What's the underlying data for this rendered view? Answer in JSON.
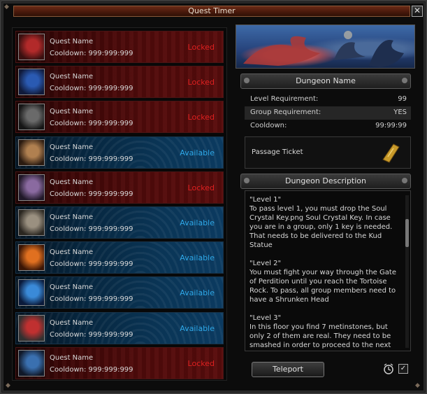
{
  "window": {
    "title": "Quest Timer",
    "close_glyph": "✕"
  },
  "quests": [
    {
      "name": "Quest Name",
      "cooldown": "Cooldown: 999:999:999",
      "status": "Locked",
      "state": "locked",
      "icon": "red-dragon-portrait-icon",
      "colors": [
        "#b22a2a",
        "#3a1010"
      ]
    },
    {
      "name": "Quest Name",
      "cooldown": "Cooldown: 999:999:999",
      "status": "Locked",
      "state": "locked",
      "icon": "blue-dragon-portrait-icon",
      "colors": [
        "#2a5ab2",
        "#101a3a"
      ]
    },
    {
      "name": "Quest Name",
      "cooldown": "Cooldown: 999:999:999",
      "status": "Locked",
      "state": "locked",
      "icon": "dark-skull-portrait-icon",
      "colors": [
        "#6a6a6a",
        "#151515"
      ]
    },
    {
      "name": "Quest Name",
      "cooldown": "Cooldown: 999:999:999",
      "status": "Available",
      "state": "available",
      "icon": "masked-face-portrait-icon",
      "colors": [
        "#b08050",
        "#2a1a10"
      ]
    },
    {
      "name": "Quest Name",
      "cooldown": "Cooldown: 999:999:999",
      "status": "Locked",
      "state": "locked",
      "icon": "purple-claw-portrait-icon",
      "colors": [
        "#8a6aa0",
        "#201828"
      ]
    },
    {
      "name": "Quest Name",
      "cooldown": "Cooldown: 999:999:999",
      "status": "Available",
      "state": "available",
      "icon": "grey-beast-portrait-icon",
      "colors": [
        "#9a9080",
        "#2a2620"
      ]
    },
    {
      "name": "Quest Name",
      "cooldown": "Cooldown: 999:999:999",
      "status": "Available",
      "state": "available",
      "icon": "fire-demon-portrait-icon",
      "colors": [
        "#e07020",
        "#3a1505"
      ]
    },
    {
      "name": "Quest Name",
      "cooldown": "Cooldown: 999:999:999",
      "status": "Available",
      "state": "available",
      "icon": "ice-crystal-portrait-icon",
      "colors": [
        "#3a8ad8",
        "#0a1a3a"
      ]
    },
    {
      "name": "Quest Name",
      "cooldown": "Cooldown: 999:999:999",
      "status": "Available",
      "state": "available",
      "icon": "eye-monster-portrait-icon",
      "colors": [
        "#c03030",
        "#303030"
      ]
    },
    {
      "name": "Quest Name",
      "cooldown": "Cooldown: 999:999:999",
      "status": "Locked",
      "state": "locked",
      "icon": "blue-bird-portrait-icon",
      "colors": [
        "#3a70b0",
        "#101828"
      ]
    }
  ],
  "dungeon": {
    "name": "Dungeon Name",
    "info": [
      {
        "label": "Level Requirement:",
        "value": "99"
      },
      {
        "label": "Group Requirement:",
        "value": "YES"
      },
      {
        "label": "Cooldown:",
        "value": "99:99:99"
      }
    ],
    "ticket_label": "Passage Ticket",
    "description_header": "Dungeon Description",
    "description": [
      "\"Level 1\"\nTo pass level 1, you must drop the Soul Crystal Key.png Soul Crystal Key. In case you are in a group, only 1 key is needed. That needs to be delivered to the Kud Statue",
      "\"Level 2\"\nYou must fight your way through the Gate of Perdition until you reach the Tortoise Rock. To pass, all group members need to have a Shrunken Head",
      "\"Level 3\"\nIn this floor you find 7 metinstones, but only 2 of them are real. They need to be smashed in order to proceed to the next"
    ],
    "teleport_label": "Teleport",
    "checkbox_glyph": "✓"
  },
  "colors": {
    "locked_text": "#e02020",
    "available_text": "#2ea8e8",
    "title_bar": "#5a2010"
  }
}
